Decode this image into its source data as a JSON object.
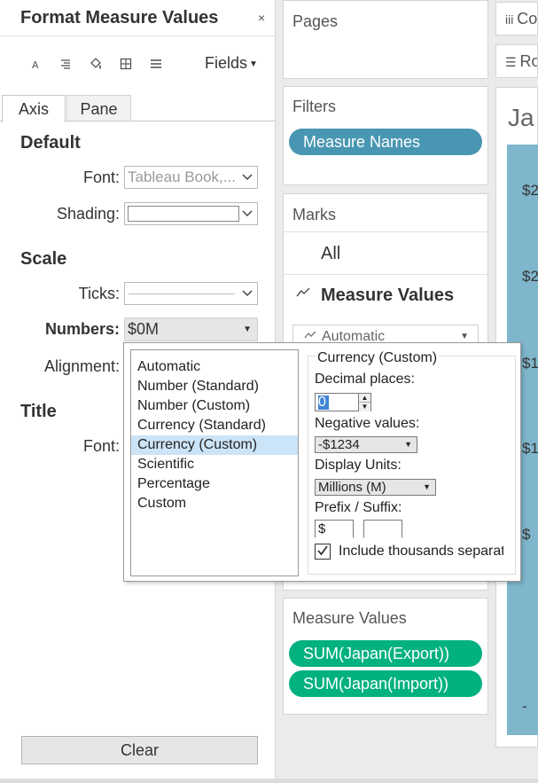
{
  "format_panel": {
    "title": "Format Measure Values",
    "close_glyph": "×",
    "fields_label": "Fields",
    "tabs": [
      "Axis",
      "Pane"
    ],
    "sections": {
      "default": "Default",
      "scale": "Scale",
      "title": "Title"
    },
    "labels": {
      "font": "Font:",
      "shading": "Shading:",
      "ticks": "Ticks:",
      "numbers": "Numbers:",
      "alignment": "Alignment:",
      "title_font": "Font:"
    },
    "font_value": "Tableau Book,...",
    "numbers_value": "$0M",
    "clear_label": "Clear"
  },
  "number_format_popup": {
    "options": [
      "Automatic",
      "Number (Standard)",
      "Number (Custom)",
      "Currency (Standard)",
      "Currency (Custom)",
      "Scientific",
      "Percentage",
      "Custom"
    ],
    "selected": "Currency (Custom)",
    "group_title": "Currency (Custom)",
    "decimal_label": "Decimal places:",
    "decimal_value": "0",
    "negative_label": "Negative values:",
    "negative_value": "-$1234",
    "units_label": "Display Units:",
    "units_value": "Millions (M)",
    "prefix_label": "Prefix / Suffix:",
    "prefix_value": "$",
    "suffix_value": "",
    "thousands_label": "Include thousands separat",
    "thousands_checked": true
  },
  "cards": {
    "pages": "Pages",
    "filters": "Filters",
    "filter_pill": "Measure Names",
    "marks": "Marks",
    "marks_all": "All",
    "marks_measure_values": "Measure Values",
    "mark_type": "Automatic",
    "measure_values": "Measure Values",
    "measure_pills": [
      "SUM(Japan(Export))",
      "SUM(Japan(Import))"
    ]
  },
  "shelves": {
    "columns": "Columns",
    "rows": "Rows"
  },
  "view": {
    "title": "Ja",
    "y_labels": [
      "$2",
      "$2",
      "$1",
      "$1",
      "$",
      "-"
    ]
  },
  "colors": {
    "filter_pill": "#4996b2",
    "measure_pill": "#02b180",
    "selected_option": "#cce4f7",
    "view_fill": "#7fb6cc"
  }
}
